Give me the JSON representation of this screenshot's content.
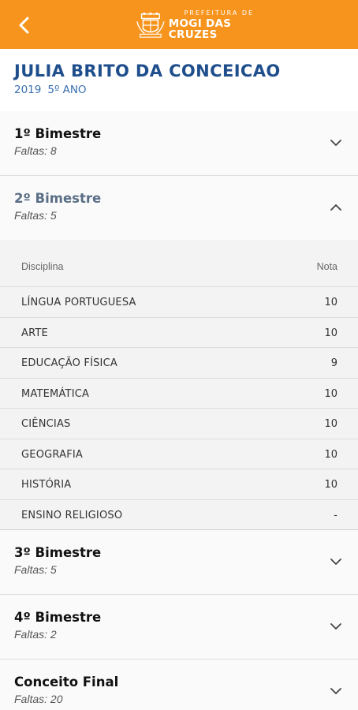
{
  "header": {
    "logo_small": "PREFEITURA DE",
    "logo_big": "MOGI DAS CRUZES",
    "bar_color": "#f7941d"
  },
  "student": {
    "name": "JULIA BRITO DA CONCEICAO",
    "year": "2019",
    "grade": "5º ANO"
  },
  "sections": [
    {
      "title": "1º Bimestre",
      "absences": "Faltas: 8",
      "expanded": false
    },
    {
      "title": "2º Bimestre",
      "absences": "Faltas: 5",
      "expanded": true
    },
    {
      "title": "3º Bimestre",
      "absences": "Faltas: 5",
      "expanded": false
    },
    {
      "title": "4º Bimestre",
      "absences": "Faltas: 2",
      "expanded": false
    },
    {
      "title": "Conceito Final",
      "absences": "Faltas: 20",
      "expanded": false
    }
  ],
  "grades_table": {
    "col_subject": "Disciplina",
    "col_grade": "Nota",
    "rows": [
      {
        "subject": "LÍNGUA PORTUGUESA",
        "grade": "10"
      },
      {
        "subject": "ARTE",
        "grade": "10"
      },
      {
        "subject": "EDUCAÇÃO FÍSICA",
        "grade": "9"
      },
      {
        "subject": "MATEMÁTICA",
        "grade": "10"
      },
      {
        "subject": "CIÊNCIAS",
        "grade": "10"
      },
      {
        "subject": "GEOGRAFIA",
        "grade": "10"
      },
      {
        "subject": "HISTÓRIA",
        "grade": "10"
      },
      {
        "subject": "ENSINO RELIGIOSO",
        "grade": "-"
      }
    ]
  }
}
